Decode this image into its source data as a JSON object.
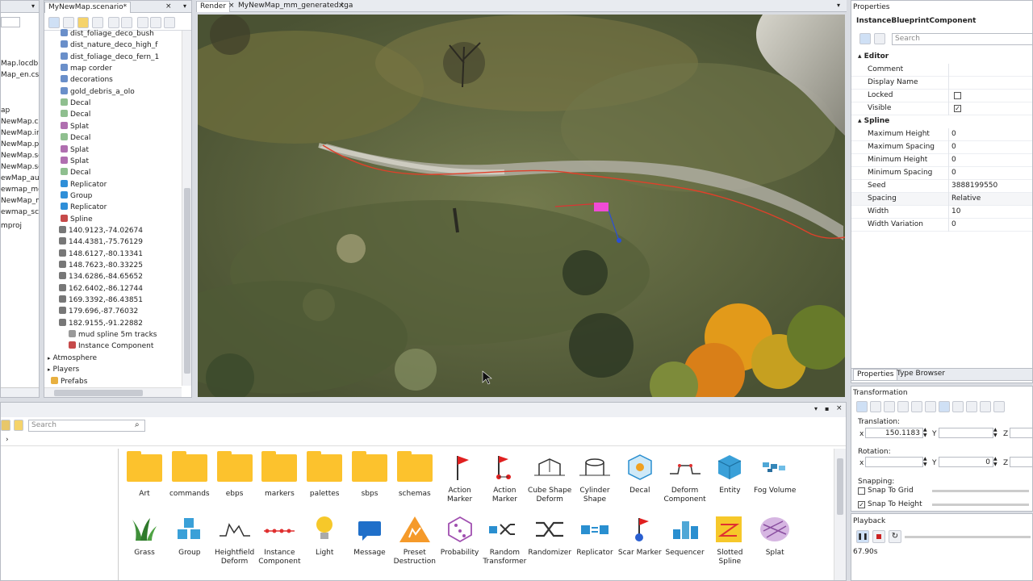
{
  "left_panel": {
    "items": [
      "Map.locdb",
      "Map_en.csv",
      "ap",
      "NewMap.cxc",
      "NewMap.inf",
      "NewMap.pre",
      "NewMap.sce",
      "NewMap.sce",
      "ewMap_aur",
      "ewmap_mo",
      "NewMap_m",
      "ewmap_sct",
      "mproj"
    ]
  },
  "scenario_tab": {
    "label": "MyNewMap.scenario*"
  },
  "tree": {
    "rows": [
      {
        "label": "dist_foliage_deco_bush",
        "indent": 20,
        "icon": "#6a8fc9"
      },
      {
        "label": "dist_nature_deco_high_f",
        "indent": 20,
        "icon": "#6a8fc9"
      },
      {
        "label": "dist_foliage_deco_fern_1",
        "indent": 20,
        "icon": "#6a8fc9"
      },
      {
        "label": "map corder",
        "indent": 20,
        "icon": "#6a8fc9"
      },
      {
        "label": "decorations",
        "indent": 20,
        "icon": "#6a8fc9"
      },
      {
        "label": "gold_debris_a_olo",
        "indent": 20,
        "icon": "#6a8fc9"
      },
      {
        "label": "Decal",
        "indent": 20,
        "icon": "#8fbf8f"
      },
      {
        "label": "Decal",
        "indent": 20,
        "icon": "#8fbf8f"
      },
      {
        "label": "Splat",
        "indent": 20,
        "icon": "#b06fb0"
      },
      {
        "label": "Decal",
        "indent": 20,
        "icon": "#8fbf8f"
      },
      {
        "label": "Splat",
        "indent": 20,
        "icon": "#b06fb0"
      },
      {
        "label": "Splat",
        "indent": 20,
        "icon": "#b06fb0"
      },
      {
        "label": "Decal",
        "indent": 20,
        "icon": "#8fbf8f"
      },
      {
        "label": "Replicator",
        "indent": 20,
        "icon": "#2f8fd8"
      },
      {
        "label": "Group",
        "indent": 20,
        "icon": "#2f8fd8"
      },
      {
        "label": "Replicator",
        "indent": 20,
        "icon": "#2f8fd8"
      },
      {
        "label": "Spline",
        "indent": 20,
        "icon": "#c64a4a"
      },
      {
        "label": "140.9123,-74.02674",
        "indent": 18,
        "icon": "#777"
      },
      {
        "label": "144.4381,-75.76129",
        "indent": 18,
        "icon": "#777"
      },
      {
        "label": "148.6127,-80.13341",
        "indent": 18,
        "icon": "#777"
      },
      {
        "label": "148.7623,-80.33225",
        "indent": 18,
        "icon": "#777"
      },
      {
        "label": "134.6286,-84.65652",
        "indent": 18,
        "icon": "#777"
      },
      {
        "label": "162.6402,-86.12744",
        "indent": 18,
        "icon": "#777"
      },
      {
        "label": "169.3392,-86.43851",
        "indent": 18,
        "icon": "#777"
      },
      {
        "label": "179.696,-87.76032",
        "indent": 18,
        "icon": "#777"
      },
      {
        "label": "182.9155,-91.22882",
        "indent": 18,
        "icon": "#777"
      },
      {
        "label": "mud spline 5m tracks",
        "indent": 30,
        "icon": "#999"
      },
      {
        "label": "Instance Component",
        "indent": 30,
        "icon": "#c64a4a"
      },
      {
        "label": "Atmosphere",
        "indent": 4,
        "icon": ""
      },
      {
        "label": "Players",
        "indent": 4,
        "icon": ""
      },
      {
        "label": "Prefabs",
        "indent": 8,
        "icon": "#e8b040"
      }
    ]
  },
  "viewport": {
    "tabs": [
      "Render",
      "MyNewMap_mm_generated.tga"
    ]
  },
  "properties": {
    "title": "Properties",
    "component": "InstanceBlueprintComponent",
    "search_placeholder": "Search",
    "groups": [
      {
        "name": "Editor",
        "rows": [
          {
            "label": "Comment",
            "value": "",
            "type": "text"
          },
          {
            "label": "Display Name",
            "value": "",
            "type": "text"
          },
          {
            "label": "Locked",
            "value": "",
            "type": "checkbox",
            "checked": false
          },
          {
            "label": "Visible",
            "value": "",
            "type": "checkbox",
            "checked": true
          }
        ]
      },
      {
        "name": "Spline",
        "rows": [
          {
            "label": "Maximum Height",
            "value": "0",
            "type": "text"
          },
          {
            "label": "Maximum Spacing",
            "value": "0",
            "type": "text"
          },
          {
            "label": "Minimum Height",
            "value": "0",
            "type": "text"
          },
          {
            "label": "Minimum Spacing",
            "value": "0",
            "type": "text"
          },
          {
            "label": "Seed",
            "value": "3888199550",
            "type": "text"
          },
          {
            "label": "Spacing",
            "value": "Relative",
            "type": "select"
          },
          {
            "label": "Width",
            "value": "10",
            "type": "text"
          },
          {
            "label": "Width Variation",
            "value": "0",
            "type": "text"
          }
        ]
      }
    ],
    "tabs": [
      "Properties",
      "Type Browser"
    ]
  },
  "transformation": {
    "title": "Transformation",
    "translation_label": "Translation:",
    "x_label": "x",
    "y_label": "Y",
    "z_label": "Z",
    "translation_x": "150.1183",
    "translation_y": "",
    "rotation_label": "Rotation:",
    "rotation_x": "",
    "rotation_y": "0",
    "snapping_label": "Snapping:",
    "snap_to_grid": "Snap To Grid",
    "snap_to_height": "Snap To Height"
  },
  "playback": {
    "title": "Playback",
    "time": "67.90s"
  },
  "asset_browser": {
    "search_placeholder": "Search",
    "path": "›",
    "row1": [
      {
        "label": "Art",
        "icon": "folder"
      },
      {
        "label": "commands",
        "icon": "folder"
      },
      {
        "label": "ebps",
        "icon": "folder"
      },
      {
        "label": "markers",
        "icon": "folder"
      },
      {
        "label": "palettes",
        "icon": "folder"
      },
      {
        "label": "sbps",
        "icon": "folder"
      },
      {
        "label": "schemas",
        "icon": "folder"
      },
      {
        "label": "Action Marker",
        "icon": "flag-red"
      },
      {
        "label": "Action Marker",
        "icon": "flag-dots"
      },
      {
        "label": "Cube Shape Deform",
        "icon": "cube-outline"
      },
      {
        "label": "Cylinder Shape",
        "icon": "cylinder-outline"
      },
      {
        "label": "Decal",
        "icon": "decal-cube"
      },
      {
        "label": "Deform Component",
        "icon": "deform"
      },
      {
        "label": "Entity",
        "icon": "entity-cube"
      },
      {
        "label": "Fog Volume",
        "icon": "fog"
      }
    ],
    "row2": [
      {
        "label": "Grass",
        "icon": "grass"
      },
      {
        "label": "Group",
        "icon": "group-cubes"
      },
      {
        "label": "Heightfield Deform",
        "icon": "heightfield"
      },
      {
        "label": "Instance Component",
        "icon": "instance"
      },
      {
        "label": "Light",
        "icon": "light"
      },
      {
        "label": "Message",
        "icon": "message"
      },
      {
        "label": "Preset Destruction",
        "icon": "destruction"
      },
      {
        "label": "Probability",
        "icon": "probability"
      },
      {
        "label": "Random Transformer",
        "icon": "random-transformer"
      },
      {
        "label": "Randomizer",
        "icon": "randomizer"
      },
      {
        "label": "Replicator",
        "icon": "replicator"
      },
      {
        "label": "Scar Marker",
        "icon": "scar-marker"
      },
      {
        "label": "Sequencer",
        "icon": "sequencer"
      },
      {
        "label": "Slotted Spline",
        "icon": "slotted-spline"
      },
      {
        "label": "Splat",
        "icon": "splat"
      }
    ]
  }
}
